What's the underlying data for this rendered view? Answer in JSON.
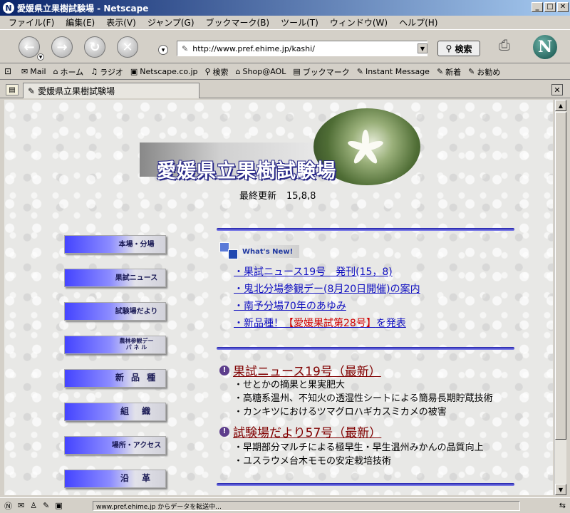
{
  "window": {
    "title": "愛媛県立果樹試験場 - Netscape"
  },
  "menu": [
    "ファイル(F)",
    "編集(E)",
    "表示(V)",
    "ジャンプ(G)",
    "ブックマーク(B)",
    "ツール(T)",
    "ウィンドウ(W)",
    "ヘルプ(H)"
  ],
  "toolbar": {
    "url": "http://www.pref.ehime.jp/kashi/",
    "search_label": "検索"
  },
  "bookmarks": [
    {
      "label": "Mail",
      "icon": "✉"
    },
    {
      "label": "ホーム",
      "icon": "⌂"
    },
    {
      "label": "ラジオ",
      "icon": "♫"
    },
    {
      "label": "Netscape.co.jp",
      "icon": "▣"
    },
    {
      "label": "検索",
      "icon": "⚲"
    },
    {
      "label": "Shop@AOL",
      "icon": "⌂"
    },
    {
      "label": "ブックマーク",
      "icon": "▤"
    },
    {
      "label": "Instant Message",
      "icon": "✎"
    },
    {
      "label": "新着",
      "icon": "✎"
    },
    {
      "label": "お勧め",
      "icon": "✎"
    }
  ],
  "tab": {
    "title": "愛媛県立果樹試験場"
  },
  "page": {
    "banner_title": "愛媛県立果樹試験場",
    "updated_label": "最終更新",
    "updated_value": "15,8,8",
    "nav": [
      "本場・分場",
      "果試ニュース",
      "試験場だより",
      "農林参観デー\nパ ネ ル",
      "新 品 種",
      "組　織",
      "場所・アクセス",
      "沿　革"
    ],
    "whats_new": "What's New!",
    "news": [
      "・果試ニュース19号　発刊(15，8)",
      "・鬼北分場参観デー(8月20日開催)の案内",
      "・南予分場70年のあゆみ"
    ],
    "news_new_variety": {
      "prefix": "・新品種！",
      "highlight": "【愛媛果試第28号】",
      "suffix": "を発表"
    },
    "section1": {
      "title": "果試ニュース19号（最新）",
      "items": [
        "・せとかの摘果と果実肥大",
        "・高糖系温州、不知火の透湿性シートによる簡易長期貯蔵技術",
        "・カンキツにおけるツマグロハギカスミカメの被害"
      ]
    },
    "section2": {
      "title": "試験場だより57号（最新）",
      "items": [
        "・早期部分マルチによる極早生・早生温州みかんの品質向上",
        "・ユスラウメ台木モモの安定栽培技術"
      ]
    }
  },
  "status": {
    "text": "www.pref.ehime.jp からデータを転送中..."
  }
}
